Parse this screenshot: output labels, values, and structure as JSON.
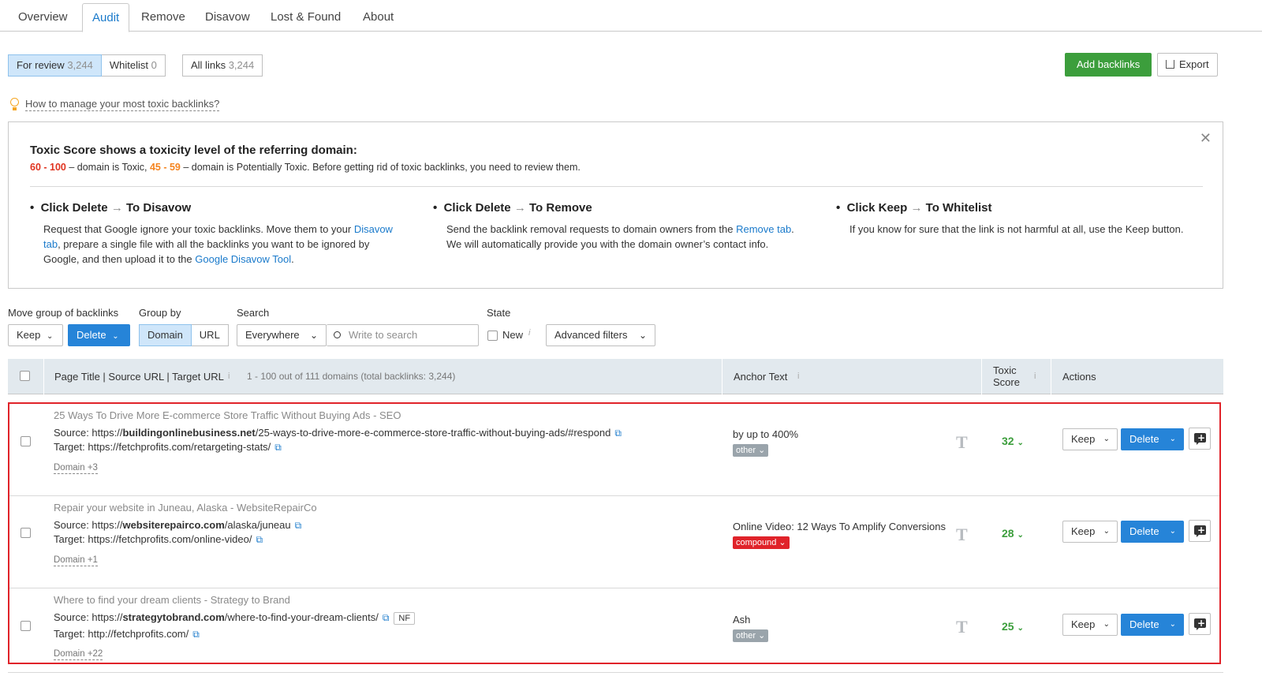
{
  "tabs": [
    "Overview",
    "Audit",
    "Remove",
    "Disavow",
    "Lost & Found",
    "About"
  ],
  "filters": {
    "for_review": "For review",
    "for_review_count": "3,244",
    "whitelist": "Whitelist",
    "whitelist_count": "0",
    "all_links": "All links",
    "all_links_count": "3,244"
  },
  "toolbar": {
    "add_backlinks": "Add backlinks",
    "export": "Export"
  },
  "hint": "How to manage your most toxic backlinks?",
  "info": {
    "heading": "Toxic Score shows a toxicity level of the referring domain:",
    "range_toxic": "60 - 100",
    "text_toxic": " – domain is Toxic, ",
    "range_potential": "45 - 59",
    "text_potential": " – domain is Potentially Toxic. Before getting rid of toxic backlinks, you need to review them.",
    "cols": [
      {
        "a": "Click Delete",
        "b": "To Disavow",
        "d1": "Request that Google ignore your toxic backlinks. Move them to your ",
        "l1": "Disavow tab",
        "d2": ", prepare a single file with all the backlinks you want to be ignored by Google, and then upload it to the ",
        "l2": "Google Disavow Tool",
        "d3": "."
      },
      {
        "a": "Click Delete",
        "b": "To Remove",
        "d1": "Send the backlink removal requests to domain owners from the ",
        "l1": "Remove tab",
        "d2": ". We will automatically provide you with the domain owner’s contact info."
      },
      {
        "a": "Click Keep",
        "b": "To Whitelist",
        "d1": "If you know for sure that the link is not harmful at all, use the Keep button."
      }
    ]
  },
  "controls": {
    "move_label": "Move group of backlinks",
    "keep": "Keep",
    "delete": "Delete",
    "group_label": "Group by",
    "domain": "Domain",
    "url": "URL",
    "search_label": "Search",
    "everywhere": "Everywhere",
    "search_placeholder": "Write to search",
    "state_label": "State",
    "new": "New",
    "advanced": "Advanced filters"
  },
  "table": {
    "col1": "Page Title | Source URL | Target URL",
    "count": "1 - 100 out of 111 domains (total backlinks: 3,244)",
    "col2": "Anchor Text",
    "col3a": "Toxic",
    "col3b": "Score",
    "col4": "Actions"
  },
  "rows": [
    {
      "title": "25 Ways To Drive More E-commerce Store Traffic Without Buying Ads - SEO",
      "source_label": "Source: ",
      "src_pre": "https://",
      "src_domain": "buildingonlinebusiness.net",
      "src_path": "/25-ways-to-drive-more-e-commerce-store-traffic-without-buying-ads/#respond",
      "target_label": "Target: ",
      "target": "https://fetchprofits.com/retargeting-stats/",
      "domain": "Domain +3",
      "anchor": "by up to 400%",
      "tag": "other",
      "score": "32",
      "nf": ""
    },
    {
      "title": "Repair your website in Juneau, Alaska - WebsiteRepairCo",
      "source_label": "Source: ",
      "src_pre": "https://",
      "src_domain": "websiterepairco.com",
      "src_path": "/alaska/juneau",
      "target_label": "Target: ",
      "target": "https://fetchprofits.com/online-video/",
      "domain": "Domain +1",
      "anchor": "Online Video: 12 Ways To Amplify Conversions",
      "tag": "compound",
      "score": "28",
      "nf": ""
    },
    {
      "title": "Where to find your dream clients - Strategy to Brand",
      "source_label": "Source: ",
      "src_pre": "https://",
      "src_domain": "strategytobrand.com",
      "src_path": "/where-to-find-your-dream-clients/",
      "target_label": "Target: ",
      "target": "http://fetchprofits.com/",
      "domain": "Domain +22",
      "anchor": "Ash",
      "tag": "other",
      "score": "25",
      "nf": "NF"
    }
  ]
}
